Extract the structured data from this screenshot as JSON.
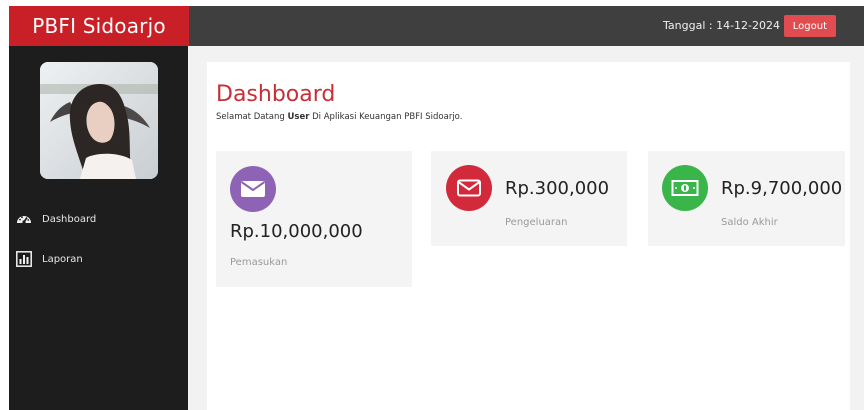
{
  "brand": {
    "title": "PBFI Sidoarjo"
  },
  "topbar": {
    "date_text": "Tanggal : 14-12-2024",
    "logout_label": "Logout"
  },
  "sidebar": {
    "items": [
      {
        "label": "Dashboard",
        "icon": "dashboard-icon"
      },
      {
        "label": "Laporan",
        "icon": "bar-chart-icon"
      }
    ]
  },
  "main": {
    "title": "Dashboard",
    "welcome_prefix": "Selamat Datang ",
    "welcome_user": "User",
    "welcome_suffix": " Di Aplikasi Keuangan PBFI Sidoarjo.",
    "cards": [
      {
        "amount": "Rp.10,000,000",
        "label": "Pemasukan",
        "icon": "envelope-icon",
        "color": "#8e63b5"
      },
      {
        "amount": "Rp.300,000",
        "label": "Pengeluaran",
        "icon": "envelope-outline-icon",
        "color": "#d22a3a"
      },
      {
        "amount": "Rp.9,700,000",
        "label": "Saldo Akhir",
        "icon": "money-icon",
        "color": "#39b54a"
      }
    ]
  },
  "colors": {
    "brand": "#c91f27",
    "topbar": "#3f3f3f",
    "sidebar": "#1d1d1d",
    "title": "#c62f36",
    "logout": "#e04c4f"
  }
}
